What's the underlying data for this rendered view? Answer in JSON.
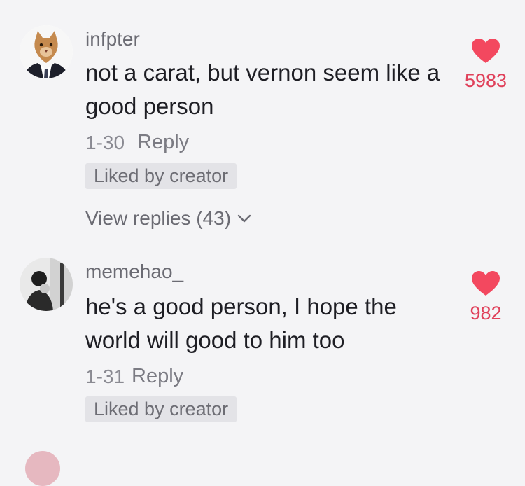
{
  "comments": [
    {
      "username": "infpter",
      "text": "not a carat, but vernon seem like a good person",
      "date": "1-30",
      "reply_label": "Reply",
      "badge": "Liked by creator",
      "view_replies": "View replies (43)",
      "likes": "5983",
      "avatar_icon": "cat-in-suit-avatar"
    },
    {
      "username": "memehao_",
      "text": "he's a good person, I hope the world will good to him too",
      "date": "1-31",
      "reply_label": "Reply",
      "badge": "Liked by creator",
      "likes": "982",
      "avatar_icon": "person-photo-avatar"
    }
  ],
  "colors": {
    "heart": "#f3485f",
    "like_count": "#e0405a",
    "background": "#f4f4f6"
  }
}
